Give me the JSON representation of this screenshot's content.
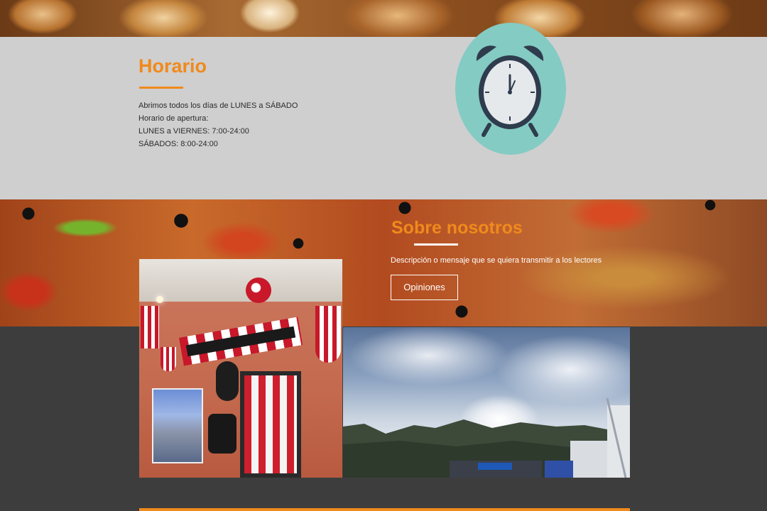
{
  "horario": {
    "title": "Horario",
    "lines": [
      "Abrimos todos los días de LUNES a SÁBADO",
      "Horario de apertura:",
      "LUNES a VIERNES: 7:00-24:00",
      "SÁBADOS: 8:00-24:00"
    ],
    "icon": "alarm-clock-icon"
  },
  "sobre": {
    "title": "Sobre nosotros",
    "description": "Descripción o mensaje que se quiera transmitir a los lectores",
    "button_label": "Opiniones"
  },
  "colors": {
    "accent": "#f08a1c",
    "section_gray": "#cfcfcf",
    "dark_bg": "#3d3d3d",
    "clock_circle": "#84cbc3",
    "clock_body": "#2f3c4d"
  }
}
